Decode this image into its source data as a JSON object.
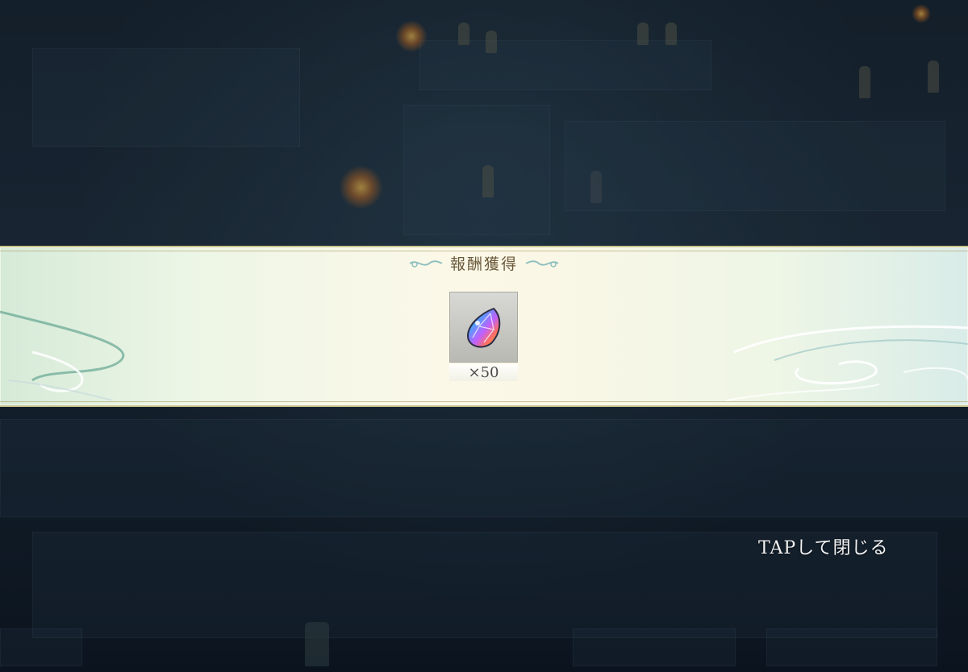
{
  "reward_popup": {
    "title": "報酬獲得",
    "item": {
      "icon": "rainbow-crystal-icon",
      "quantity_label": "×50"
    }
  },
  "close_hint": "TAPして閉じる",
  "colors": {
    "banner_border": "#c9c48f",
    "title_text": "#6b5a3c",
    "close_text": "#f2f2f2"
  }
}
